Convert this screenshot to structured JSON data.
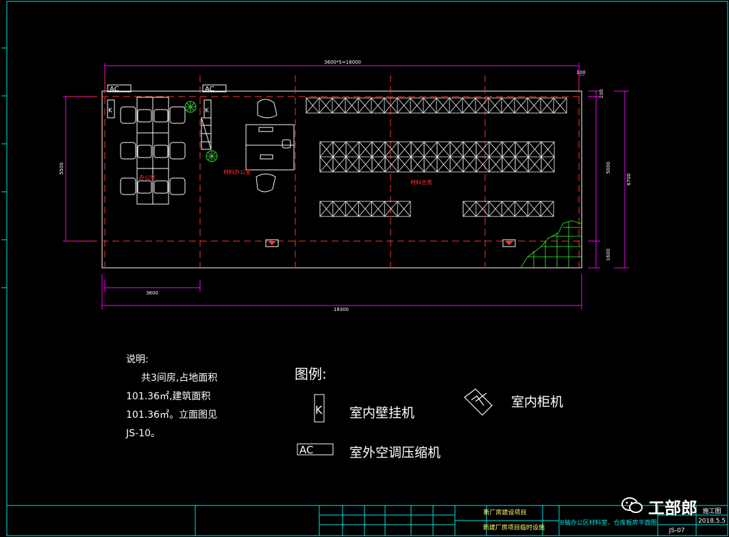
{
  "dimensions": {
    "top_total": "3600*5=18000",
    "top_right_small": "100",
    "right_inner_top": "100",
    "right_inner_mid": "5000",
    "right_outer": "6700",
    "right_inner_bottom": "1600",
    "left_height": "5500",
    "bottom_room": "3600",
    "bottom_total": "18300"
  },
  "rooms": {
    "office_left": "办公室",
    "office_mid": "材料办公室",
    "warehouse": "材料仓库"
  },
  "symbols": {
    "ac": "AC",
    "k": "K"
  },
  "notes": {
    "title": "说明:",
    "line1": "共3间房,占地面积",
    "line2": "101.36㎡,建筑面积",
    "line3": "101.36㎡。立面图见",
    "line4": "JS-10。"
  },
  "legend": {
    "title": "图例:",
    "wall_unit": "室内壁挂机",
    "cabinet_unit": "室内柜机",
    "outdoor_unit": "室外空调压缩机"
  },
  "title_block": {
    "project": "新厂房建设项目",
    "subproject": "新建厂房项目临时设施",
    "drawing_name": "B轴办公区材料室、仓库板房平面图",
    "stage": "施工图",
    "date": "2018.5.5",
    "drawing_no": "JS-07"
  },
  "watermark": "工部郎",
  "colors": {
    "frame": "#00e5e5",
    "dimension": "#ff00ff",
    "wall": "#ff3333",
    "furniture": "#ffffff",
    "hatch": "#33ff33"
  }
}
